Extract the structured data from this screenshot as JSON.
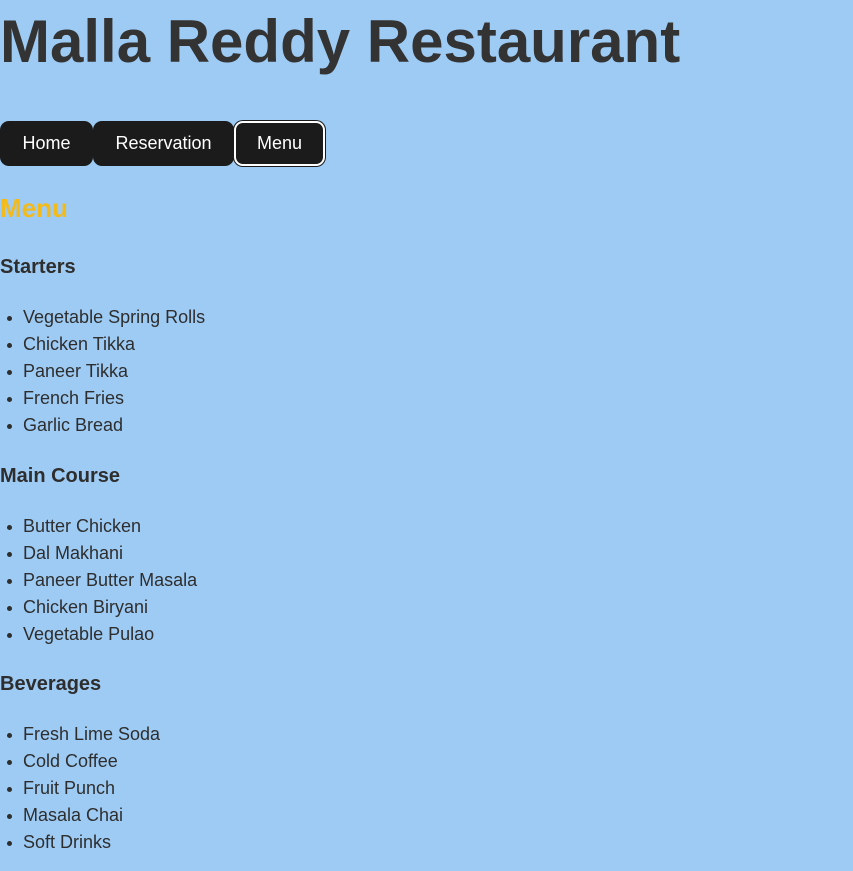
{
  "site": {
    "title": "Malla Reddy Restaurant"
  },
  "nav": {
    "home_label": "Home",
    "reservation_label": "Reservation",
    "menu_label": "Menu",
    "active": "Menu"
  },
  "page": {
    "heading": "Menu"
  },
  "menu": {
    "starters": {
      "title": "Starters",
      "items": [
        "Vegetable Spring Rolls",
        "Chicken Tikka",
        "Paneer Tikka",
        "French Fries",
        "Garlic Bread"
      ]
    },
    "main_course": {
      "title": "Main Course",
      "items": [
        "Butter Chicken",
        "Dal Makhani",
        "Paneer Butter Masala",
        "Chicken Biryani",
        "Vegetable Pulao"
      ]
    },
    "beverages": {
      "title": "Beverages",
      "items": [
        "Fresh Lime Soda",
        "Cold Coffee",
        "Fruit Punch",
        "Masala Chai",
        "Soft Drinks"
      ]
    }
  },
  "colors": {
    "background": "#9ecbf4",
    "nav_button": "#1b1b1b",
    "heading_accent": "#f2bb1b",
    "text": "#2e2e2e"
  }
}
